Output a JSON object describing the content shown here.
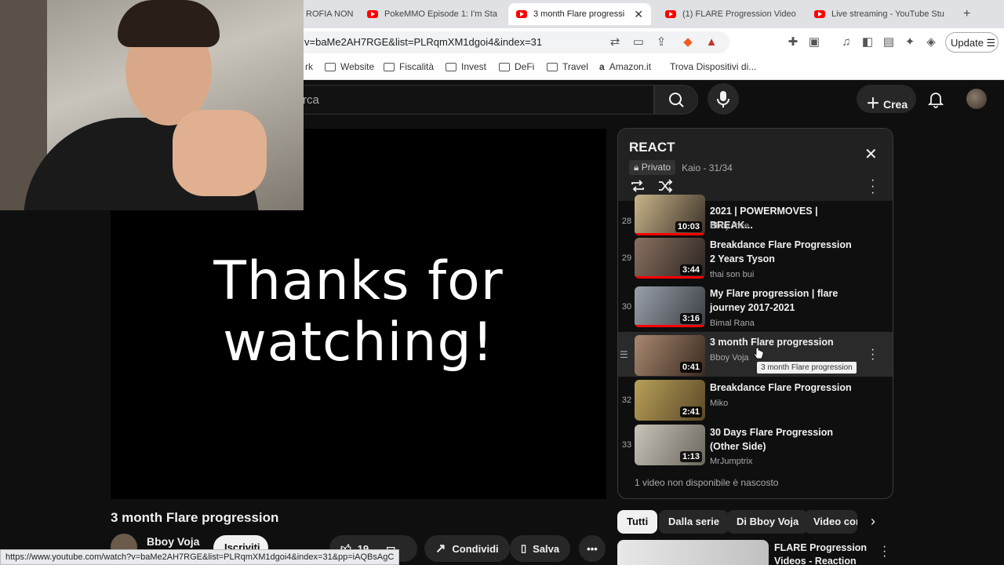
{
  "browser": {
    "tabs": [
      {
        "label": "ROFIA NON",
        "active": false
      },
      {
        "label": "PokeMMO Episode 1: I'm Sta",
        "active": false
      },
      {
        "label": "3 month Flare progressic",
        "active": true
      },
      {
        "label": "(1) FLARE Progression Video",
        "active": false
      },
      {
        "label": "Live streaming - YouTube Stu",
        "active": false
      }
    ],
    "new_tab": "+",
    "url": "v=baMe2AH7RGE&list=PLRqmXM1dgoi4&index=31",
    "update_label": "Update",
    "bookmarks": [
      "rk",
      "Website",
      "Fiscalità",
      "Invest",
      "DeFi",
      "Travel",
      "Amazon.it",
      "Trova Dispositivi di..."
    ],
    "status_url": "https://www.youtube.com/watch?v=baMe2AH7RGE&list=PLRqmXM1dgoi4&index=31&pp=iAQBsAgC"
  },
  "header": {
    "search_placeholder": "rca",
    "create_label": "Crea"
  },
  "video": {
    "overlay_line1": "Thanks for",
    "overlay_line2": "watching!",
    "title": "3 month Flare progression",
    "channel": "Bboy Voja",
    "subscribe_label": "Iscriviti",
    "likes": "19",
    "share_label": "Condividi",
    "save_label": "Salva"
  },
  "playlist": {
    "title": "REACT",
    "privacy": "Privato",
    "owner_position": "Kaio - 31/34",
    "items": [
      {
        "num": "28",
        "title": "2021 | POWERMOVES | BREAK...",
        "channel": "Bboy Rice",
        "duration": "10:03",
        "thumb_colors": [
          "#c9b48a",
          "#3b3228"
        ]
      },
      {
        "num": "29",
        "title": "Breakdance Flare Progression 2 Years Tyson",
        "channel": "thai son bui",
        "duration": "3:44",
        "thumb_colors": [
          "#8a7060",
          "#2a2420"
        ]
      },
      {
        "num": "30",
        "title": "My Flare progression | flare journey 2017-2021",
        "channel": "Bimal Rana",
        "duration": "3:16",
        "thumb_colors": [
          "#9aa0a8",
          "#3a3e44"
        ]
      },
      {
        "num": "",
        "title": "3 month Flare progression",
        "channel": "Bboy Voja",
        "duration": "0:41",
        "thumb_colors": [
          "#a88870",
          "#3a2a20"
        ]
      },
      {
        "num": "32",
        "title": "Breakdance Flare Progression",
        "channel": "Miko",
        "duration": "2:41",
        "thumb_colors": [
          "#b8a058",
          "#5a4828"
        ]
      },
      {
        "num": "33",
        "title": "30 Days Flare Progression (Other Side)",
        "channel": "MrJumptrix",
        "duration": "1:13",
        "thumb_colors": [
          "#c8c4b8",
          "#6a665c"
        ]
      }
    ],
    "hidden_note": "1 video non disponibile è nascosto",
    "tooltip": "3 month Flare progression"
  },
  "chips": [
    "Tutti",
    "Dalla serie",
    "Di Bboy Voja",
    "Video cor"
  ],
  "recommendation": {
    "title_line1": "FLARE Progression",
    "title_line2": "Videos - Reaction"
  },
  "colors": {
    "bg": "#0f0f0f",
    "accent": "#ff0000",
    "panel": "#212121"
  }
}
